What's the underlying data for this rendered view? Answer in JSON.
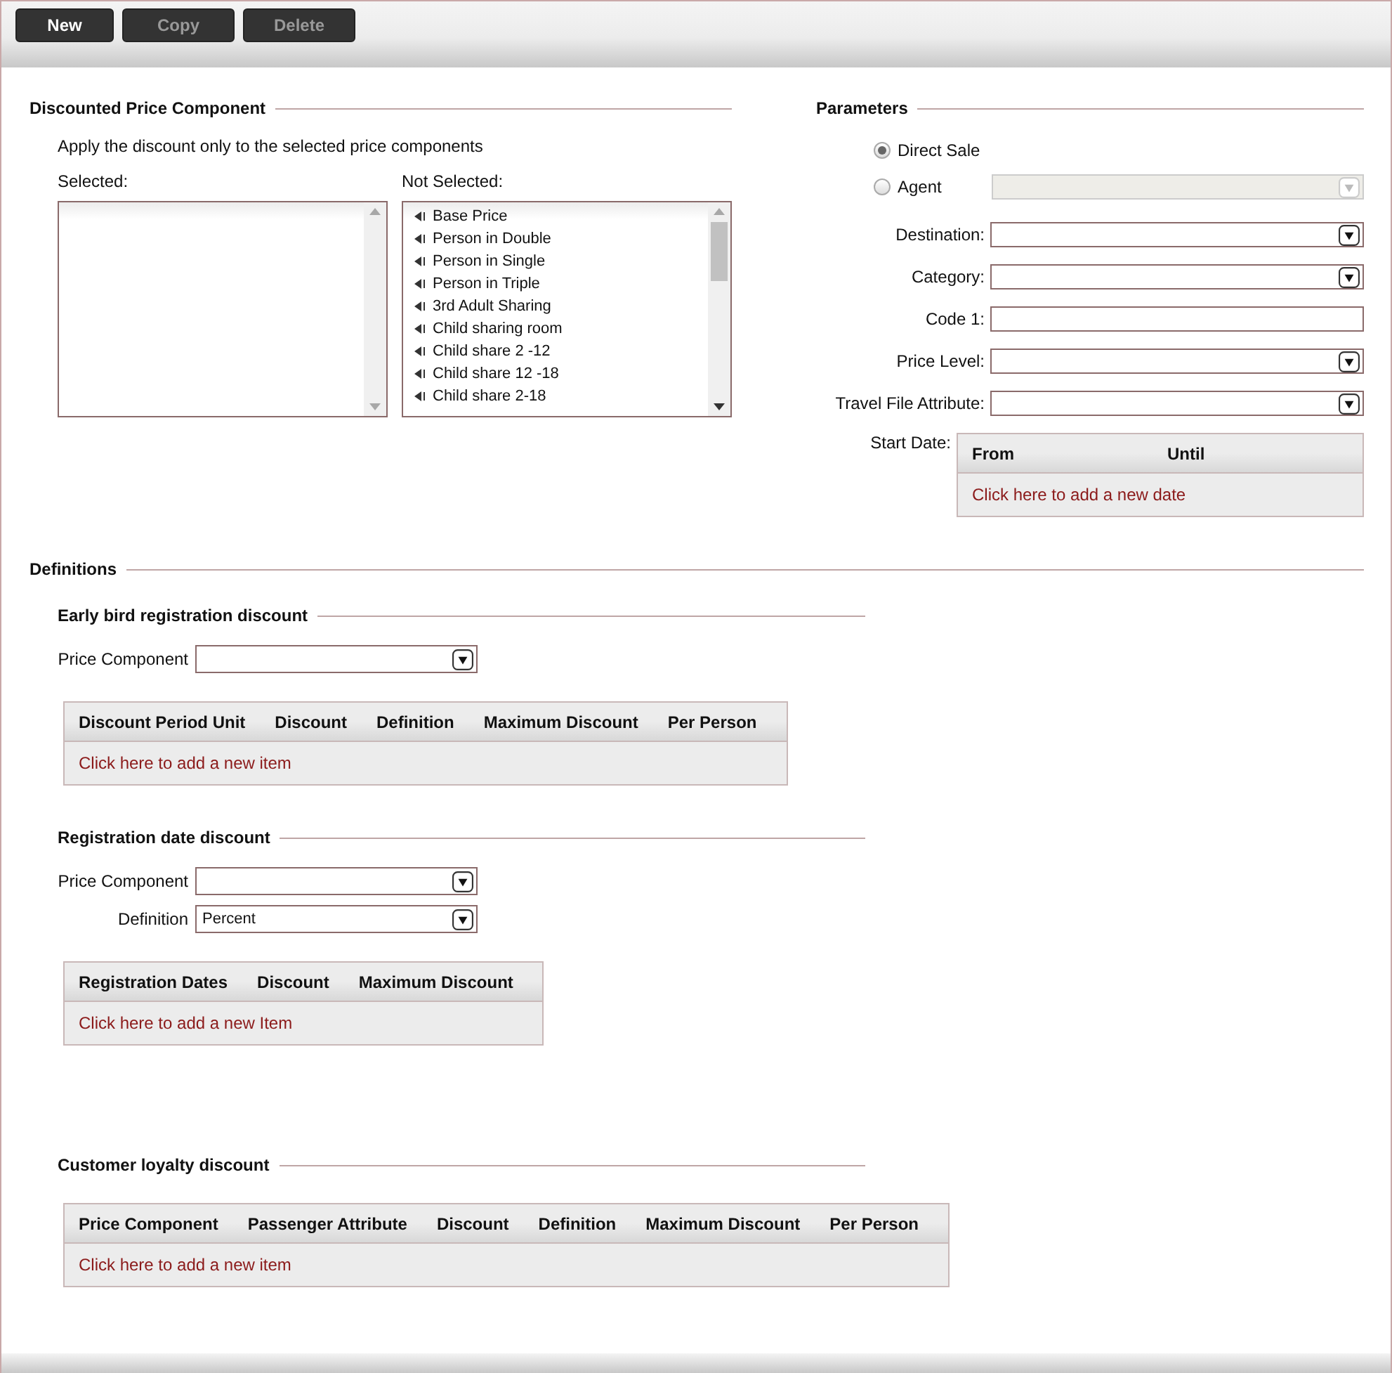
{
  "toolbar": {
    "buttons": [
      {
        "label": "New",
        "disabled": false
      },
      {
        "label": "Copy",
        "disabled": true
      },
      {
        "label": "Delete",
        "disabled": true
      }
    ]
  },
  "discounted_price_component": {
    "title": "Discounted Price Component",
    "hint": "Apply the discount only to the selected price components",
    "selected_label": "Selected:",
    "not_selected_label": "Not Selected:",
    "not_selected_items": [
      "Base Price",
      "Person in Double",
      "Person in Single",
      "Person in Triple",
      "3rd Adult Sharing",
      "Child sharing room",
      "Child share 2 -12",
      "Child share 12 -18",
      "Child share 2-18"
    ]
  },
  "parameters": {
    "title": "Parameters",
    "sale_type": [
      {
        "label": "Direct Sale",
        "selected": true
      },
      {
        "label": "Agent",
        "selected": false
      }
    ],
    "agent_dropdown": {
      "disabled": true
    },
    "fields": [
      {
        "label": "Destination:",
        "kind": "dropdown"
      },
      {
        "label": "Category:",
        "kind": "dropdown"
      },
      {
        "label": "Code 1:",
        "kind": "text"
      },
      {
        "label": "Price Level:",
        "kind": "dropdown"
      },
      {
        "label": "Travel File Attribute:",
        "kind": "dropdown"
      }
    ],
    "start_date": {
      "label": "Start Date:",
      "columns": [
        "From",
        "Until"
      ],
      "add_link": "Click here to add a new date"
    }
  },
  "definitions": {
    "title": "Definitions",
    "sections": [
      {
        "title": "Early bird registration discount",
        "fields": [
          {
            "label": "Price Component"
          }
        ],
        "table": {
          "columns": [
            "Discount Period Unit",
            "Discount",
            "Definition",
            "Maximum Discount",
            "Per Person"
          ],
          "add_link": "Click here to add a new item"
        }
      },
      {
        "title": "Registration date discount",
        "fields": [
          {
            "label": "Price Component"
          },
          {
            "label": "Definition",
            "value": "Percent"
          }
        ],
        "table": {
          "columns": [
            "Registration Dates",
            "Discount",
            "Maximum Discount"
          ],
          "add_link": "Click here to add a new Item"
        }
      },
      {
        "title": "Customer loyalty discount",
        "table": {
          "columns": [
            "Price Component",
            "Passenger Attribute",
            "Discount",
            "Definition",
            "Maximum Discount",
            "Per Person"
          ],
          "add_link": "Click here to add a new item"
        }
      }
    ]
  }
}
